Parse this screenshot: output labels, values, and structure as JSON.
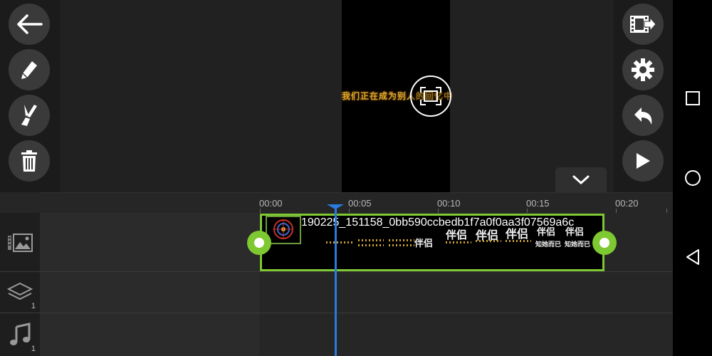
{
  "preview": {
    "caption": "我们正在成为别人的回忆中"
  },
  "left_toolbar": {
    "items": [
      {
        "name": "back",
        "icon": "arrow-left-icon"
      },
      {
        "name": "edit",
        "icon": "pencil-icon"
      },
      {
        "name": "effects",
        "icon": "brush-icon"
      },
      {
        "name": "delete",
        "icon": "trash-icon"
      }
    ]
  },
  "right_toolbar": {
    "items": [
      {
        "name": "export",
        "icon": "film-export-icon"
      },
      {
        "name": "settings",
        "icon": "gear-icon"
      },
      {
        "name": "undo",
        "icon": "undo-icon"
      },
      {
        "name": "play",
        "icon": "play-icon"
      }
    ]
  },
  "timeline": {
    "ticks": [
      "00:00",
      "00:05",
      "00:10",
      "00:15",
      "00:20"
    ],
    "tracks": {
      "media": {
        "icon": "media-track-icon"
      },
      "layers": {
        "icon": "layers-icon",
        "count": "1"
      },
      "audio": {
        "icon": "music-note-icon",
        "count": "1"
      }
    },
    "clip": {
      "name": "190225_151158_0bb590ccbedb1f7a0f0aa3f07569a6c",
      "overlay_texts": [
        "伴侣",
        "伴侣",
        "伴侣",
        "伴侣",
        "伴侣",
        "伴侣",
        "知她而已",
        "知她而已"
      ]
    }
  },
  "colors": {
    "accent_green": "#7ec832",
    "playhead_blue": "#2a7be0",
    "caption_gold": "#d9a52a"
  }
}
